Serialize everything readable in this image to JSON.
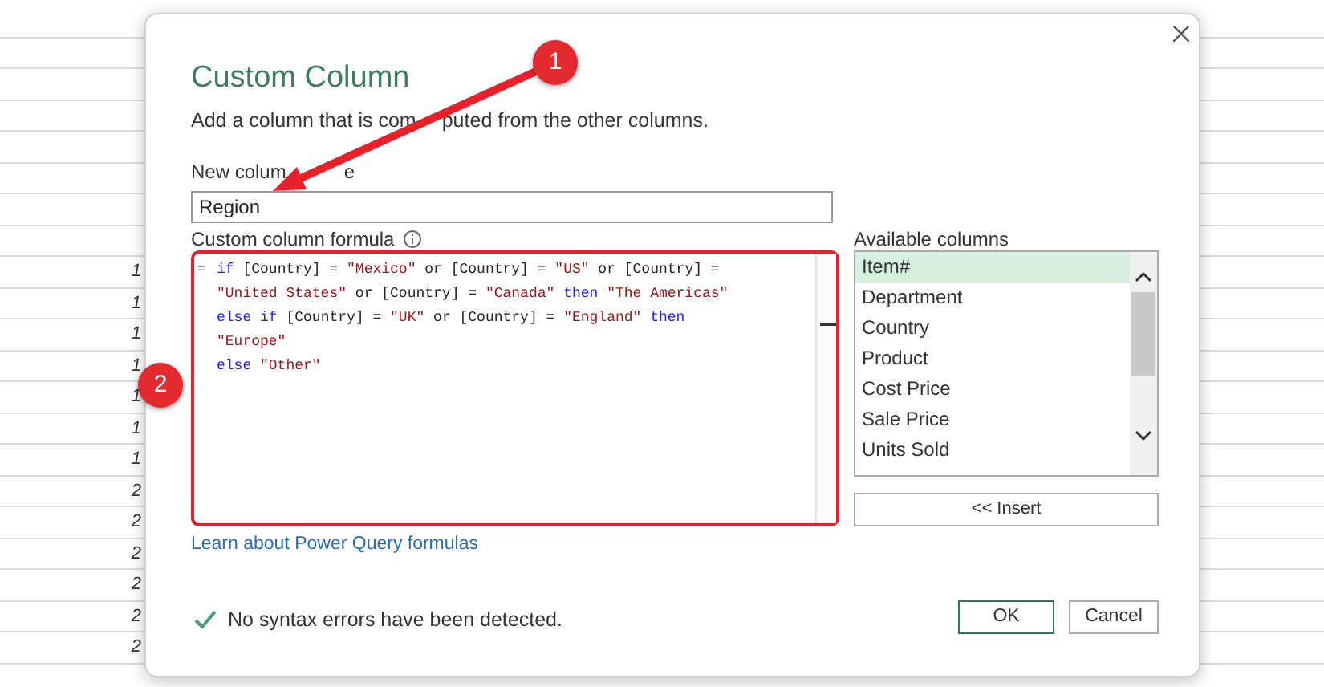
{
  "sheet": {
    "row_numbers": [
      "1",
      "1",
      "1",
      "1",
      "1",
      "1",
      "1",
      "2",
      "2",
      "2",
      "2",
      "2",
      "2"
    ]
  },
  "dialog": {
    "title": "Custom Column",
    "subtitle_parts": [
      "Add a column that is com",
      "puted from the other columns."
    ],
    "name_label_parts": [
      "New colum",
      "e"
    ],
    "name_value": "Region",
    "formula_label": "Custom column formula",
    "formula_prefix": "=",
    "formula_lines": [
      [
        {
          "kind": "keyword",
          "text": "if"
        },
        {
          "kind": "plain",
          "text": " [Country] = "
        },
        {
          "kind": "string",
          "text": "\"Mexico\""
        },
        {
          "kind": "plain",
          "text": " or [Country] = "
        },
        {
          "kind": "string",
          "text": "\"US\""
        },
        {
          "kind": "plain",
          "text": " or [Country] ="
        }
      ],
      [
        {
          "kind": "string",
          "text": "\"United States\""
        },
        {
          "kind": "plain",
          "text": " or [Country] = "
        },
        {
          "kind": "string",
          "text": "\"Canada\""
        },
        {
          "kind": "keyword",
          "text": " then"
        },
        {
          "kind": "string",
          "text": " \"The Americas\""
        }
      ],
      [
        {
          "kind": "keyword",
          "text": "else"
        },
        {
          "kind": "keyword",
          "text": " if"
        },
        {
          "kind": "plain",
          "text": " [Country] = "
        },
        {
          "kind": "string",
          "text": "\"UK\""
        },
        {
          "kind": "plain",
          "text": " or [Country] = "
        },
        {
          "kind": "string",
          "text": "\"England\""
        },
        {
          "kind": "keyword",
          "text": " then"
        }
      ],
      [
        {
          "kind": "string",
          "text": "\"Europe\""
        }
      ],
      [
        {
          "kind": "keyword",
          "text": "else"
        },
        {
          "kind": "string",
          "text": " \"Other\""
        }
      ]
    ],
    "columns_label": "Available columns",
    "columns": [
      {
        "label": "Item#",
        "selected": true
      },
      {
        "label": "Department",
        "selected": false
      },
      {
        "label": "Country",
        "selected": false
      },
      {
        "label": "Product",
        "selected": false
      },
      {
        "label": "Cost Price",
        "selected": false
      },
      {
        "label": "Sale Price",
        "selected": false
      },
      {
        "label": "Units Sold",
        "selected": false
      }
    ],
    "insert_button": "<< Insert",
    "link": "Learn about Power Query formulas",
    "status": "No syntax errors have been detected.",
    "buttons": [
      "OK",
      "Cancel"
    ]
  },
  "annotations": [
    "1",
    "2"
  ]
}
